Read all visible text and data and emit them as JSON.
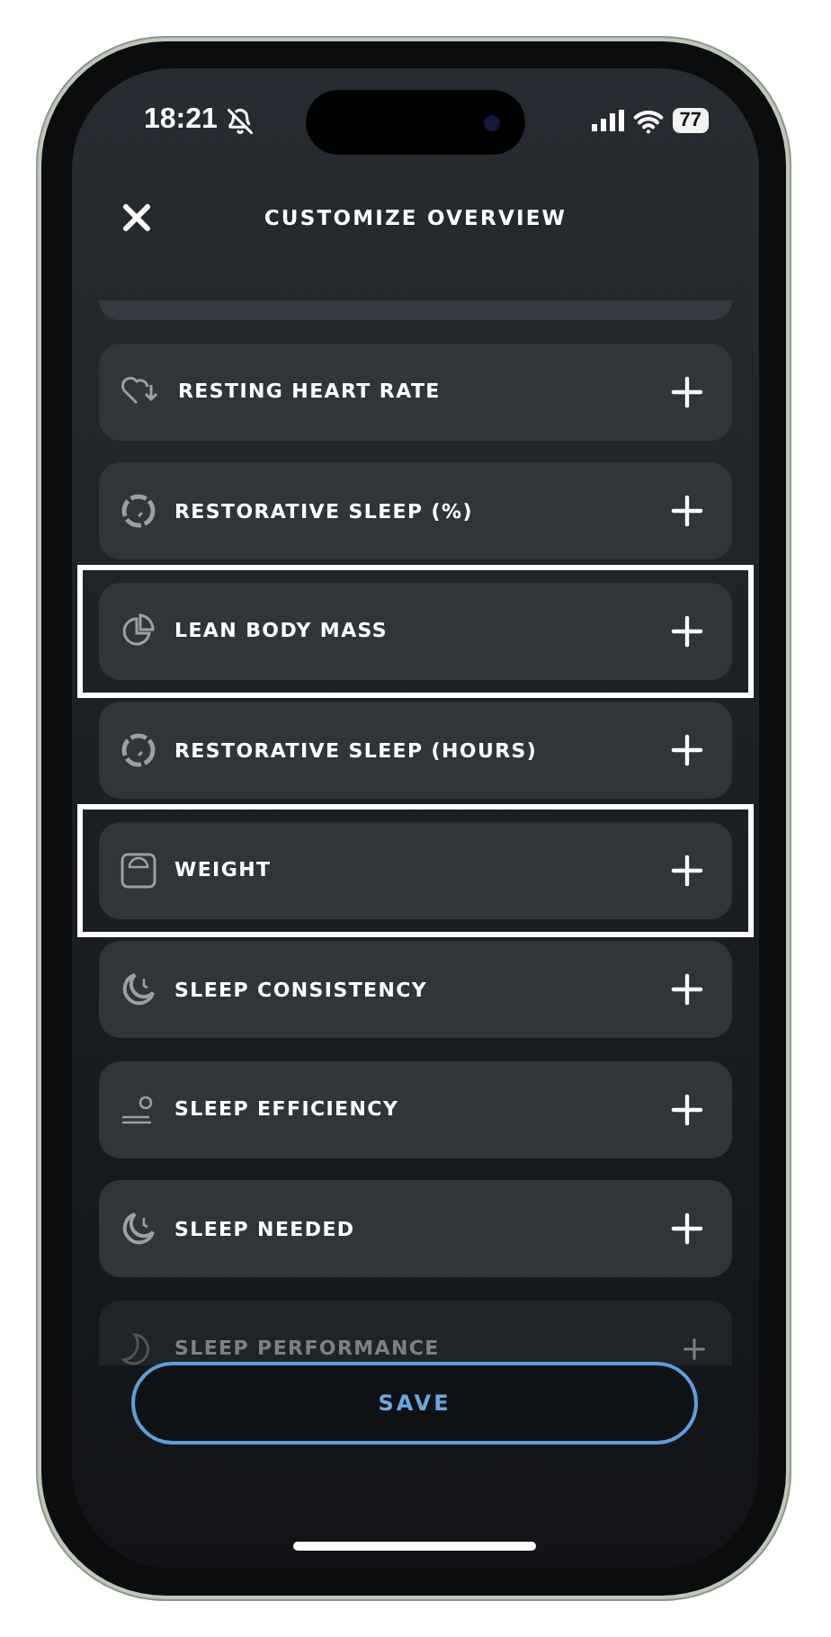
{
  "status_bar": {
    "time": "18:21",
    "battery": "77"
  },
  "header": {
    "title": "CUSTOMIZE OVERVIEW"
  },
  "metrics": [
    {
      "label": "RESTING HEART RATE",
      "kind": "heart",
      "highlighted": false,
      "dimmed": false
    },
    {
      "label": "RESTORATIVE SLEEP (%)",
      "kind": "dial",
      "highlighted": false,
      "dimmed": false
    },
    {
      "label": "LEAN BODY MASS",
      "kind": "pie",
      "highlighted": true,
      "dimmed": false
    },
    {
      "label": "RESTORATIVE SLEEP (HOURS)",
      "kind": "dial",
      "highlighted": false,
      "dimmed": false
    },
    {
      "label": "WEIGHT",
      "kind": "scale",
      "highlighted": true,
      "dimmed": false
    },
    {
      "label": "SLEEP CONSISTENCY",
      "kind": "moonclock",
      "highlighted": false,
      "dimmed": false
    },
    {
      "label": "SLEEP EFFICIENCY",
      "kind": "sleeper",
      "highlighted": false,
      "dimmed": false
    },
    {
      "label": "SLEEP NEEDED",
      "kind": "moonclock",
      "highlighted": false,
      "dimmed": false
    },
    {
      "label": "SLEEP PERFORMANCE",
      "kind": "moon",
      "highlighted": false,
      "dimmed": true
    }
  ],
  "save_button": {
    "label": "SAVE"
  }
}
